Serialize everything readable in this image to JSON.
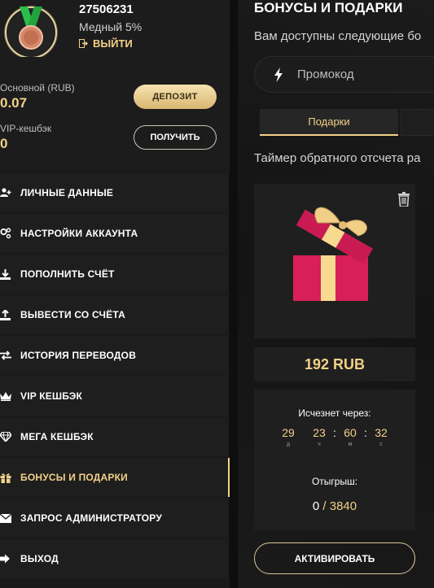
{
  "profile": {
    "user_id": "27506231",
    "rank": "Медный 5%",
    "logout_label": "ВЫЙТИ",
    "main_balance_label": "Основной (RUB)",
    "main_balance_value": "0.07",
    "vip_cashback_label": "VIP-кешбэк",
    "vip_cashback_value": "0",
    "deposit_label": "ДЕПОЗИТ",
    "get_label": "ПОЛУЧИТЬ"
  },
  "menu": [
    {
      "label": "ЛИЧНЫЕ ДАННЫЕ",
      "icon": "user-plus-icon"
    },
    {
      "label": "НАСТРОЙКИ АККАУНТА",
      "icon": "settings-icon"
    },
    {
      "label": "ПОПОЛНИТЬ СЧЁТ",
      "icon": "download-icon"
    },
    {
      "label": "ВЫВЕСТИ СО СЧЁТА",
      "icon": "upload-icon"
    },
    {
      "label": "ИСТОРИЯ ПЕРЕВОДОВ",
      "icon": "transfer-icon"
    },
    {
      "label": "VIP КЕШБЭК",
      "icon": "crown-icon"
    },
    {
      "label": "МЕГА КЕШБЭК",
      "icon": "diamond-icon"
    },
    {
      "label": "БОНУСЫ И ПОДАРКИ",
      "icon": "gift-icon",
      "active": true
    },
    {
      "label": "ЗАПРОС АДМИНИСТРАТОРУ",
      "icon": "envelope-icon"
    },
    {
      "label": "ВЫХОД",
      "icon": "exit-icon"
    }
  ],
  "main": {
    "title": "БОНУСЫ И ПОДАРКИ",
    "subtitle": "Вам доступны следующие бо",
    "promo_placeholder": "Промокод",
    "tabs": [
      {
        "label": "Подарки"
      }
    ],
    "timer_note": "Таймер обратного отсчета ра"
  },
  "gift": {
    "amount": "192 RUB",
    "expires_label": "Исчезнет через:",
    "timer": [
      {
        "value": "29",
        "unit": "д"
      },
      {
        "value": "23",
        "unit": "ч"
      },
      {
        "value": "60",
        "unit": "м"
      },
      {
        "value": "32",
        "unit": "с"
      }
    ],
    "wager_label": "Отыгрыш:",
    "wager_current": "0",
    "wager_separator": "/",
    "wager_required": "3840",
    "activate_label": "АКТИВИРОВАТЬ"
  },
  "colors": {
    "accent": "#f2d188",
    "gift_box": "#d81f5a",
    "gift_ribbon": "#f7d98f",
    "medal_ribbon": "#2bbf4a"
  }
}
